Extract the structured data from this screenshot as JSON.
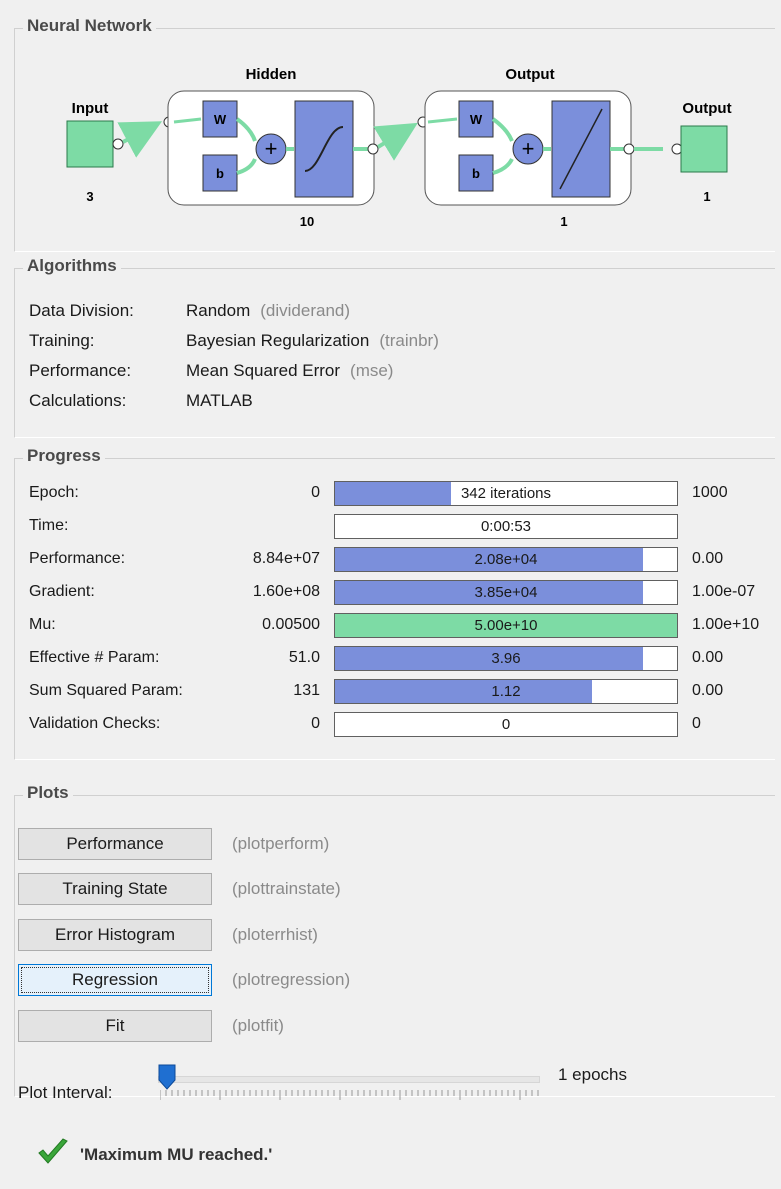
{
  "neural_network": {
    "title": "Neural Network",
    "input_label": "Input",
    "input_size": "3",
    "hidden_label": "Hidden",
    "hidden_size": "10",
    "output_layer_label": "Output",
    "output_layer_size": "1",
    "output_label": "Output",
    "output_size": "1",
    "weight_symbol": "W",
    "bias_symbol": "b",
    "colors": {
      "node": "#7ddba5",
      "block": "#7b8fdb"
    }
  },
  "algorithms": {
    "title": "Algorithms",
    "rows": [
      {
        "label": "Data Division:",
        "value": "Random",
        "fn": "(dividerand)"
      },
      {
        "label": "Training:",
        "value": "Bayesian Regularization",
        "fn": "(trainbr)"
      },
      {
        "label": "Performance:",
        "value": "Mean Squared Error",
        "fn": "(mse)"
      },
      {
        "label": "Calculations:",
        "value": "MATLAB",
        "fn": ""
      }
    ]
  },
  "progress": {
    "title": "Progress",
    "rows": [
      {
        "label": "Epoch:",
        "start": "0",
        "value": "342 iterations",
        "end": "1000",
        "fill": 0.34,
        "color": "#7b8fdb"
      },
      {
        "label": "Time:",
        "start": "",
        "value": "0:00:53",
        "end": "",
        "fill": 0,
        "color": "#7b8fdb"
      },
      {
        "label": "Performance:",
        "start": "8.84e+07",
        "value": "2.08e+04",
        "end": "0.00",
        "fill": 0.9,
        "color": "#7b8fdb"
      },
      {
        "label": "Gradient:",
        "start": "1.60e+08",
        "value": "3.85e+04",
        "end": "1.00e-07",
        "fill": 0.9,
        "color": "#7b8fdb"
      },
      {
        "label": "Mu:",
        "start": "0.00500",
        "value": "5.00e+10",
        "end": "1.00e+10",
        "fill": 1.0,
        "color": "#7ddba5"
      },
      {
        "label": "Effective # Param:",
        "start": "51.0",
        "value": "3.96",
        "end": "0.00",
        "fill": 0.9,
        "color": "#7b8fdb"
      },
      {
        "label": "Sum Squared Param:",
        "start": "131",
        "value": "1.12",
        "end": "0.00",
        "fill": 0.75,
        "color": "#7b8fdb"
      },
      {
        "label": "Validation Checks:",
        "start": "0",
        "value": "0",
        "end": "0",
        "fill": 0,
        "color": "#7b8fdb"
      }
    ]
  },
  "plots": {
    "title": "Plots",
    "buttons": [
      {
        "label": "Performance",
        "fn": "(plotperform)"
      },
      {
        "label": "Training State",
        "fn": "(plottrainstate)"
      },
      {
        "label": "Error Histogram",
        "fn": "(ploterrhist)"
      },
      {
        "label": "Regression",
        "fn": "(plotregression)"
      },
      {
        "label": "Fit",
        "fn": "(plotfit)"
      }
    ],
    "interval_label": "Plot Interval:",
    "interval_value": "1 epochs"
  },
  "status": {
    "icon": "checkmark-icon",
    "text": "'Maximum MU reached.'"
  }
}
